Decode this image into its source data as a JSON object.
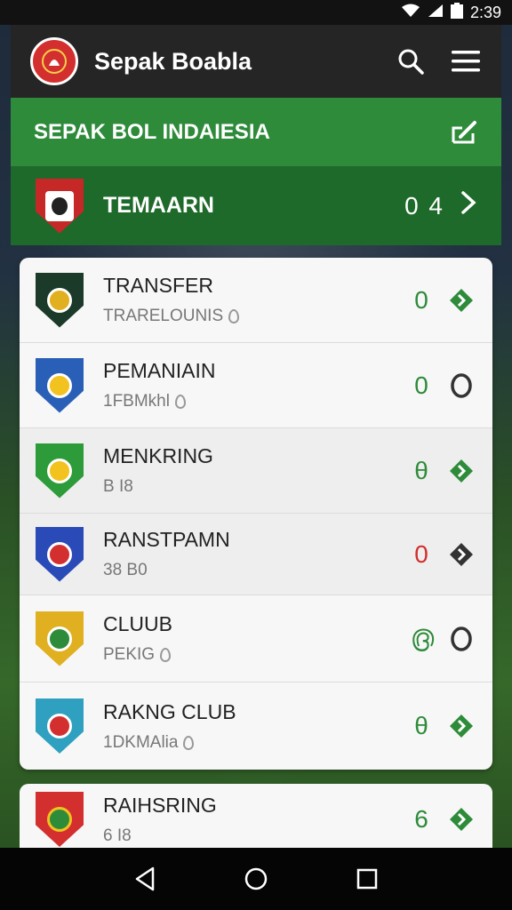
{
  "status_bar": {
    "time": "2:39"
  },
  "app_bar": {
    "title": "Sepak Boabla"
  },
  "section": {
    "title": "SEPAK BOL INDAIESIA"
  },
  "featured": {
    "name": "TEMAARN",
    "score": "0 4"
  },
  "rows": [
    {
      "name": "TRANSFER",
      "sub": "TRARELOUNIS",
      "score": "0",
      "score_color": "#2e8b3a",
      "action": "green-diamond",
      "badge_colors": [
        "#1b3a2a",
        "#e0b020"
      ]
    },
    {
      "name": "PEMANIAIN",
      "sub": "1FBMkhl",
      "score": "0",
      "score_color": "#2e8b3a",
      "action": "O",
      "badge_colors": [
        "#2a5fb8",
        "#f2c21f"
      ]
    },
    {
      "name": "MENKRING",
      "sub": "B I8",
      "score": "θ",
      "score_color": "#2e8b3a",
      "action": "green-diamond",
      "badge_colors": [
        "#2e9b3a",
        "#f2c21f"
      ]
    },
    {
      "name": "RANSTPAMN",
      "sub": "38 B0",
      "score": "0",
      "score_color": "#d32f2f",
      "action": "dark-diamond",
      "badge_colors": [
        "#2a4ab8",
        "#d32f2f"
      ]
    },
    {
      "name": "CLUUB",
      "sub": "PEKIG",
      "score": "൫",
      "score_color": "#2e8b3a",
      "action": "O",
      "badge_colors": [
        "#e0b020",
        "#2e8b3a"
      ]
    },
    {
      "name": "RAKNG CLUB",
      "sub": "1DKMAlia",
      "score": "θ",
      "score_color": "#2e8b3a",
      "action": "green-diamond",
      "badge_colors": [
        "#2fa0c0",
        "#d32f2f"
      ]
    }
  ],
  "partial_row": {
    "name": "RAIHSRING",
    "sub": "6 I8",
    "score": "6",
    "score_color": "#2e8b3a"
  },
  "colors": {
    "app_bar": "#252525",
    "section_green": "#2e8b3a",
    "featured_green": "#1e6a2a",
    "accent_green": "#2e8b3a",
    "accent_red": "#d32f2f"
  }
}
